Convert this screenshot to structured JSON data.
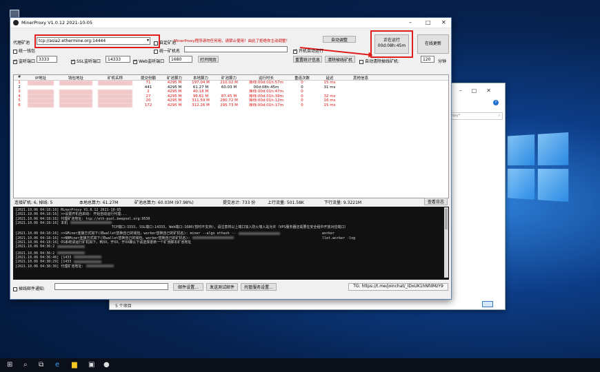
{
  "desktop": {
    "recycle_label": ""
  },
  "explorer": {
    "search_placeholder": "roxy*",
    "item_count": "5 个项目"
  },
  "window": {
    "title": "MinerProxy V1.0.12 2021-10-05"
  },
  "config": {
    "proxy_label": "代理矿池",
    "proxy_value": "tcp://asia2.ethermine.org:14444",
    "custom_pool_label": "自定矿池",
    "warning": "MinerProxy程序请勿任何用，请禁止使用！由此了拒绝你主动调整！",
    "start_flush_btn": "自动调整",
    "running_btn_line1": "正在运行",
    "running_btn_line2": "00d:08h:45m",
    "online_update_btn": "在线更新",
    "unified_wallet_label": "统一钱包",
    "unified_miner_label": "统一矿机名",
    "autostart_label": "开机自动运行",
    "listen_port_label": "监听端口",
    "listen_port_value": "3333",
    "ssl_port_label": "SSL监听端口",
    "ssl_port_value": "14333",
    "web_port_label": "Web监听端口",
    "web_port_value": "1680",
    "open_web_btn": "打开网页",
    "reset_stats_btn": "重置统计信息",
    "clear_offline_btn": "清除掉线矿机",
    "auto_clear_label": "自动清除掉线矿机:",
    "auto_clear_value": "120",
    "auto_clear_unit": "分钟"
  },
  "table": {
    "headers": [
      "#",
      "IP地址",
      "钱包地址",
      "矿机名称",
      "提交份额",
      "矿池算力",
      "本地算力",
      "矿池算力",
      "运行时长",
      "重连次数",
      "延迟",
      "其他信息"
    ],
    "rows": [
      {
        "n": "1",
        "ip": "",
        "wallet": "",
        "miner": "",
        "shares": "71",
        "pool": "4295 M",
        "local": "197.04 M",
        "hash2": "210.02 M",
        "uptime": "掉线:00d:01h:57m",
        "reconn": "0",
        "delay": "15 ms",
        "other": "",
        "red": true
      },
      {
        "n": "2",
        "ip": "",
        "wallet": "",
        "miner": "",
        "shares": "441",
        "pool": "4295 M",
        "local": "61.27 M",
        "hash2": "60.03 M",
        "uptime": "00d:08h:45m",
        "reconn": "0",
        "delay": "31 ms",
        "other": "",
        "red": false
      },
      {
        "n": "3",
        "ip": "",
        "wallet": "",
        "miner": "",
        "shares": "2",
        "pool": "4295 M",
        "local": "40.18 M",
        "hash2": "",
        "uptime": "掉线:00d:01h:47m",
        "reconn": "0",
        "delay": "",
        "other": "",
        "red": true
      },
      {
        "n": "4",
        "ip": "",
        "wallet": "",
        "miner": "",
        "shares": "27",
        "pool": "4295 M",
        "local": "96.61 M",
        "hash2": "87.45 M",
        "uptime": "掉线:00d:01h:39m",
        "reconn": "0",
        "delay": "32 ms",
        "other": "",
        "red": true
      },
      {
        "n": "5",
        "ip": "",
        "wallet": "",
        "miner": "",
        "shares": "20",
        "pool": "4295 M",
        "local": "311.59 M",
        "hash2": "280.72 M",
        "uptime": "掉线:00d:01h:12m",
        "reconn": "0",
        "delay": "16 ms",
        "other": "",
        "red": true
      },
      {
        "n": "6",
        "ip": "",
        "wallet": "",
        "miner": "",
        "shares": "172",
        "pool": "4295 M",
        "local": "312.26 M",
        "hash2": "295.73 M",
        "uptime": "掉线:00d:01h:17m",
        "reconn": "0",
        "delay": "15 ms",
        "other": "",
        "red": true
      }
    ]
  },
  "status": {
    "connected": "连接矿机: 6, 掉线: 5",
    "local_total": "本地总算力: 61.27M",
    "pool_total": "矿池总算力: 60.03M (97.98%)",
    "submitted": "提交总计: 733 份",
    "upload": "上行流量: 501.58K",
    "download": "下行流量: 9.3221M",
    "view_log_btn": "查看日志"
  },
  "log": [
    "[2021.10.06 04:18:16] MinerProxy V1.0.12 2021-10-05",
    "[2021.10.06 04:18:16] >>设置开机自启动: 开始自动运行代理...",
    "[2021.10.06 04:18:16] 代理矿池地址: tcp://eth-pool.beepool.org:9530",
    "[2021.10.06 04:18:16] 本机",
    "TCP端口:3333, SSL端口:14333, Web端口:1680(暂时不支持)，请注意将以上端口加入防火墙入站允许（VPS服务器还需要在安全组中开放对应端口）",
    "[2021.10.06 04:18:16] >>GMiner连接方式如下(将wallet替换自己的钱包，worker替换自己的矿机名): miner --algo ethash --",
    "worker",
    "[2021.10.06 04:18:16] >>NBMiner连接方式如下(将wallet替换自己的钱包，worker替换自己的矿机名):",
    "llet.worker -log",
    "[2021.10.06 04:18:16] OS系统请运行矿机如下，到XX，开XX，开XX确认下请选择更新一个矿池脚本矿池地址",
    "[2021.10.06 04:36:2",
    "[2021.10.06 04:36:2",
    "[2021.10.06 04:36:46] [1433",
    "[2021.10.06 04:38:29] [1433",
    "[2021.10.06 04:38:30] 代理矿池地址:"
  ],
  "footer": {
    "email_label": "掉线邮件通知:",
    "email_settings_btn": "邮件设置...",
    "send_test_btn": "发送测试邮件",
    "hosting_btn": "托管服务设置...",
    "tg_link": "TG: https://t.me/joinchat/_lDxUK1hNfdMzY9"
  }
}
